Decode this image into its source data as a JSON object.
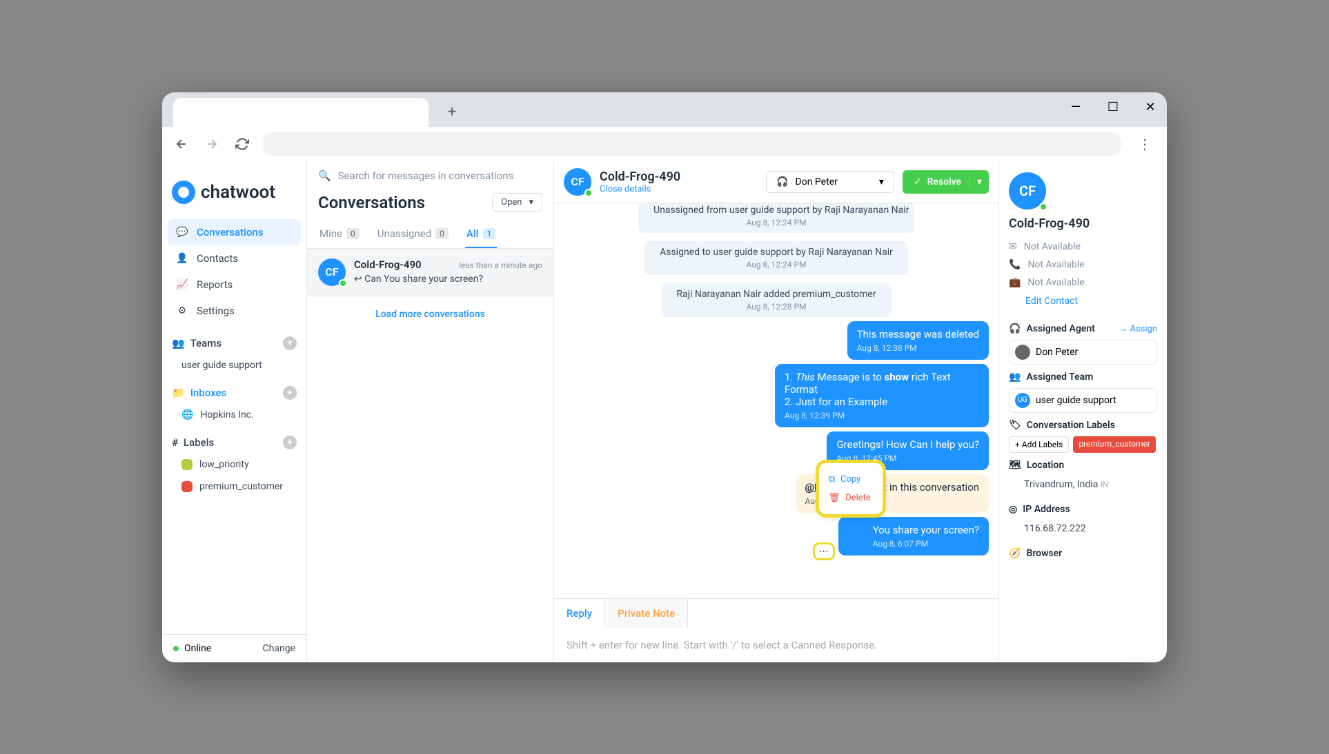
{
  "app": {
    "name": "chatwoot"
  },
  "sidebar": {
    "nav": [
      {
        "label": "Conversations",
        "icon": "💬"
      },
      {
        "label": "Contacts",
        "icon": "👤"
      },
      {
        "label": "Reports",
        "icon": "📈"
      },
      {
        "label": "Settings",
        "icon": "⚙"
      }
    ],
    "teams_label": "Teams",
    "teams": [
      {
        "name": "user guide support"
      }
    ],
    "inboxes_label": "Inboxes",
    "inboxes": [
      {
        "name": "Hopkins Inc."
      }
    ],
    "labels_label": "Labels",
    "labels": [
      {
        "name": "low_priority",
        "color": "#b8ca42"
      },
      {
        "name": "premium_customer",
        "color": "#e74c3c"
      }
    ],
    "status": "Online",
    "change": "Change"
  },
  "conv_list": {
    "search_placeholder": "Search for messages in conversations",
    "title": "Conversations",
    "status_filter": "Open",
    "tabs": [
      {
        "label": "Mine",
        "count": "0"
      },
      {
        "label": "Unassigned",
        "count": "0"
      },
      {
        "label": "All",
        "count": "1"
      }
    ],
    "items": [
      {
        "initials": "CF",
        "name": "Cold-Frog-490",
        "time": "less than a minute ago",
        "preview": "↩ Can You share your screen?"
      }
    ],
    "load_more": "Load more conversations"
  },
  "chat": {
    "title": "Cold-Frog-490",
    "close_details": "Close details",
    "agent": "Don Peter",
    "resolve": "Resolve",
    "sys": [
      {
        "text": "Unassigned from user guide support by Raji Narayanan Nair",
        "ts": "Aug 8, 12:24 PM"
      },
      {
        "text": "Assigned to user guide support by Raji Narayanan Nair",
        "ts": "Aug 8, 12:24 PM"
      },
      {
        "text": "Raji Narayanan Nair added premium_customer",
        "ts": "Aug 8, 12:28 PM"
      }
    ],
    "msgs": {
      "deleted": {
        "text": "This message was deleted",
        "ts": "Aug 8, 12:38 PM"
      },
      "rich": {
        "line1a": "1. ",
        "line1b": "This",
        "line1c": " Message is to ",
        "line1d": "show",
        "line1e": " rich Text Format",
        "line2": "2. Just for an Example",
        "ts": "Aug 8, 12:39 PM"
      },
      "greet": {
        "text": "Greetings! How Can I help you?",
        "ts": "Aug 8, 12:45 PM"
      },
      "note": {
        "prefix": "@Don",
        "rest": "oubt in this conversation",
        "ts": "Aug 8, 12:45 PM"
      },
      "share": {
        "text": "You share your screen?",
        "ts": "Aug 8, 6:07 PM"
      }
    },
    "context_menu": {
      "copy": "Copy",
      "delete": "Delete"
    },
    "reply_tabs": {
      "reply": "Reply",
      "note": "Private Note"
    },
    "reply_placeholder": "Shift + enter for new line. Start with '/' to select a Canned Response."
  },
  "details": {
    "initials": "CF",
    "name": "Cold-Frog-490",
    "na": "Not Available",
    "edit": "Edit Contact",
    "assigned_agent_label": "Assigned Agent",
    "assign": "Assign",
    "agent_name": "Don Peter",
    "assigned_team_label": "Assigned Team",
    "team_name": "user guide support",
    "labels_label": "Conversation Labels",
    "add_labels": "+ Add Labels",
    "label_premium": "premium_customer",
    "location_label": "Location",
    "location": "Trivandrum, India",
    "country_code": "IN",
    "ip_label": "IP Address",
    "ip": "116.68.72.222",
    "browser_label": "Browser"
  }
}
